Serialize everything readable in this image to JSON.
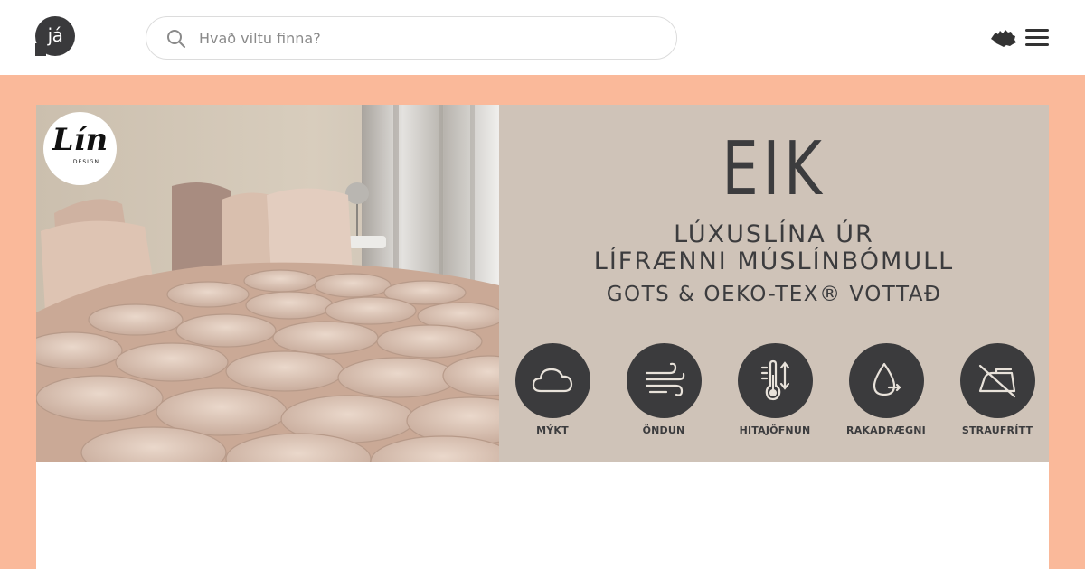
{
  "header": {
    "logo_text": "já",
    "search": {
      "placeholder": "Hvað viltu finna?"
    },
    "icons": {
      "search": "search-icon",
      "region": "iceland-map-icon",
      "menu": "hamburger-menu-icon"
    }
  },
  "banner": {
    "badge": {
      "name": "Lín",
      "sub": "DESIGN"
    },
    "brand": "EIK",
    "tagline_line1": "LÚXUSLÍNA ÚR",
    "tagline_line2": "LÍFRÆNNI MÚSLÍNBÓMULL",
    "certification": "GOTS & OEKO-TEX® VOTTAÐ",
    "features": [
      {
        "label": "MÝKT",
        "icon": "cloud-icon"
      },
      {
        "label": "ÖNDUN",
        "icon": "wind-icon"
      },
      {
        "label": "HITAJÖFNUN",
        "icon": "thermometer-icon"
      },
      {
        "label": "RAKADRÆGNI",
        "icon": "droplet-icon"
      },
      {
        "label": "STRAUFRÍTT",
        "icon": "no-iron-icon"
      }
    ]
  },
  "colors": {
    "page_background": "#fab99a",
    "panel_background": "#cfc3b8",
    "dark": "#3b3b3d"
  }
}
